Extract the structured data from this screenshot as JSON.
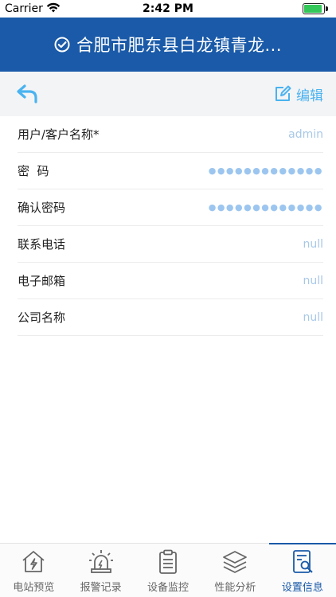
{
  "status_bar": {
    "carrier": "Carrier",
    "time": "2:42 PM"
  },
  "header": {
    "title": "合肥市肥东县白龙镇青龙..."
  },
  "action_bar": {
    "back_icon": "back-arrow-icon",
    "edit_label": "编辑"
  },
  "form": {
    "rows": [
      {
        "label": "用户/客户名称*",
        "value": "admin"
      },
      {
        "label": "密  码",
        "value": "●●●●●●●●●●●●●"
      },
      {
        "label": "确认密码",
        "value": "●●●●●●●●●●●●●"
      },
      {
        "label": "联系电话",
        "value": "null"
      },
      {
        "label": "电子邮箱",
        "value": "null"
      },
      {
        "label": "公司名称",
        "value": "null"
      }
    ]
  },
  "tabs": [
    {
      "label": "电站预览",
      "icon": "station-home-icon"
    },
    {
      "label": "报警记录",
      "icon": "alarm-siren-icon"
    },
    {
      "label": "设备监控",
      "icon": "clipboard-icon"
    },
    {
      "label": "性能分析",
      "icon": "layers-icon"
    },
    {
      "label": "设置信息",
      "icon": "settings-document-icon",
      "active": true
    }
  ],
  "colors": {
    "header_bg": "#1a5aa8",
    "accent": "#4ab3f0",
    "value_text": "#a8c8e8"
  }
}
